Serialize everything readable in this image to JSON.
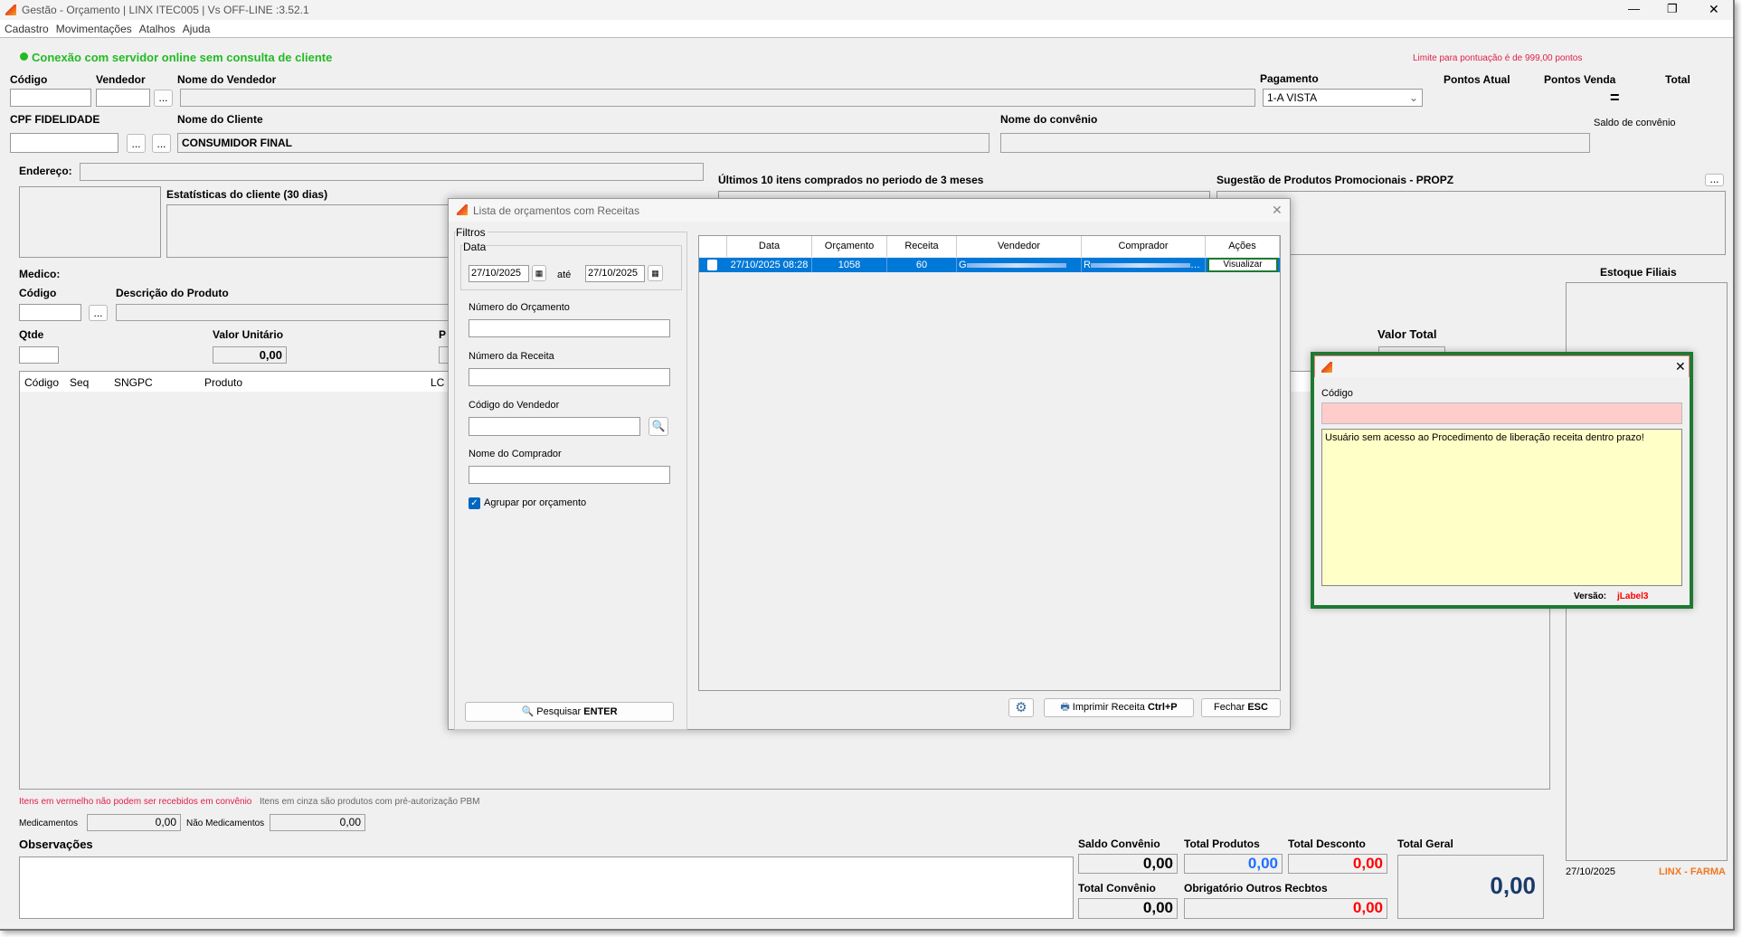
{
  "window": {
    "title": "Gestão - Orçamento  | LINX ITEC005 | Vs OFF-LINE :3.52.1",
    "minimize": "—",
    "restore": "❐",
    "close": "✕"
  },
  "menu": [
    "Cadastro",
    "Movimentações",
    "Atalhos",
    "Ajuda"
  ],
  "status": {
    "connection": "Conexão com servidor online sem consulta de cliente",
    "limit": "Limite para pontuação é de 999,00 pontos"
  },
  "form": {
    "codigo_label": "Código",
    "vendedor_label": "Vendedor",
    "nome_vendedor_label": "Nome do Vendedor",
    "pagamento_label": "Pagamento",
    "pagamento_value": "1-A VISTA",
    "pontos_atual": "Pontos Atual",
    "pontos_venda": "Pontos Venda",
    "total": "Total",
    "equals": "=",
    "saldo_convenio": "Saldo de convênio",
    "cpf_label": "CPF FIDELIDADE",
    "nome_cliente_label": "Nome do Cliente",
    "nome_cliente_value": "CONSUMIDOR FINAL",
    "nome_convenio_label": "Nome do convênio",
    "endereco_label": "Endereço:",
    "estatisticas_label": "Estatísticas do cliente  (30 dias)",
    "ultimos_label": "Últimos 10 itens comprados no periodo de 3 meses",
    "sugestao_label": "Sugestão de Produtos Promocionais - PROPZ",
    "medico_label": "Medico:",
    "prod_codigo_label": "Código",
    "descricao_label": "Descrição do Produto",
    "qtde_label": "Qtde",
    "valor_unitario_label": "Valor Unitário",
    "valor_unitario_value": "0,00",
    "p_label": "P",
    "valor_total_label": "Valor Total",
    "estoque_label": "Estoque Filiais",
    "ellipsis": "..."
  },
  "items_table": {
    "columns": [
      "Código",
      "Seq",
      "SNGPC",
      "Produto",
      "LC"
    ]
  },
  "notes": {
    "red": "Itens em vermelho não podem ser recebidos em convênio",
    "grey": "Itens em cinza são produtos com pré-autorização PBM"
  },
  "totals": {
    "medicamentos_label": "Medicamentos",
    "medicamentos_value": "0,00",
    "nao_med_label": "Não Medicamentos",
    "nao_med_value": "0,00",
    "observacoes_label": "Observações",
    "saldo_convenio_label": "Saldo Convênio",
    "saldo_convenio_value": "0,00",
    "total_produtos_label": "Total Produtos",
    "total_produtos_value": "0,00",
    "total_desconto_label": "Total Desconto",
    "total_desconto_value": "0,00",
    "total_geral_label": "Total Geral",
    "total_geral_value": "0,00",
    "total_convenio_label": "Total Convênio",
    "total_convenio_value": "0,00",
    "obrigatorio_label": "Obrigatório Outros Recbtos",
    "obrigatorio_value": "0,00",
    "date": "27/10/2025",
    "brand": "LINX - FARMA"
  },
  "dialog": {
    "title": "Lista de orçamentos com Receitas",
    "close": "✕",
    "filtros": "Filtros",
    "data": "Data",
    "date_from": "27/10/2025",
    "ate": "até",
    "date_to": "27/10/2025",
    "num_orcamento": "Número do Orçamento",
    "num_receita": "Número da Receita",
    "cod_vendedor": "Código do Vendedor",
    "nome_comprador": "Nome do Comprador",
    "agrupar": "Agrupar por orçamento",
    "pesquisar": "Pesquisar",
    "pesquisar_key": "ENTER",
    "columns": [
      "",
      "Data",
      "Orçamento",
      "Receita",
      "Vendedor",
      "Comprador",
      "Ações"
    ],
    "rows": [
      {
        "data": "27/10/2025 08:28",
        "orcamento": "1058",
        "receita": "60",
        "vendedor": "G",
        "comprador": "R",
        "acao": "Visualizar"
      }
    ],
    "imprimir": "Imprimir Receita",
    "imprimir_key": "Ctrl+P",
    "fechar": "Fechar",
    "fechar_key": "ESC"
  },
  "popup": {
    "close": "✕",
    "codigo_label": "Código",
    "message": "Usuário sem acesso ao Procedimento de liberação receita dentro prazo!",
    "versao_label": "Versão:",
    "versao_value": "jLabel3"
  },
  "colors": {
    "green": "#22bb22",
    "red": "#ff0000",
    "blue": "#1e6fff",
    "selection": "#0078d7",
    "popup_border": "#1e7a32",
    "pink": "#ffcccc",
    "yellow": "#ffffc8"
  }
}
